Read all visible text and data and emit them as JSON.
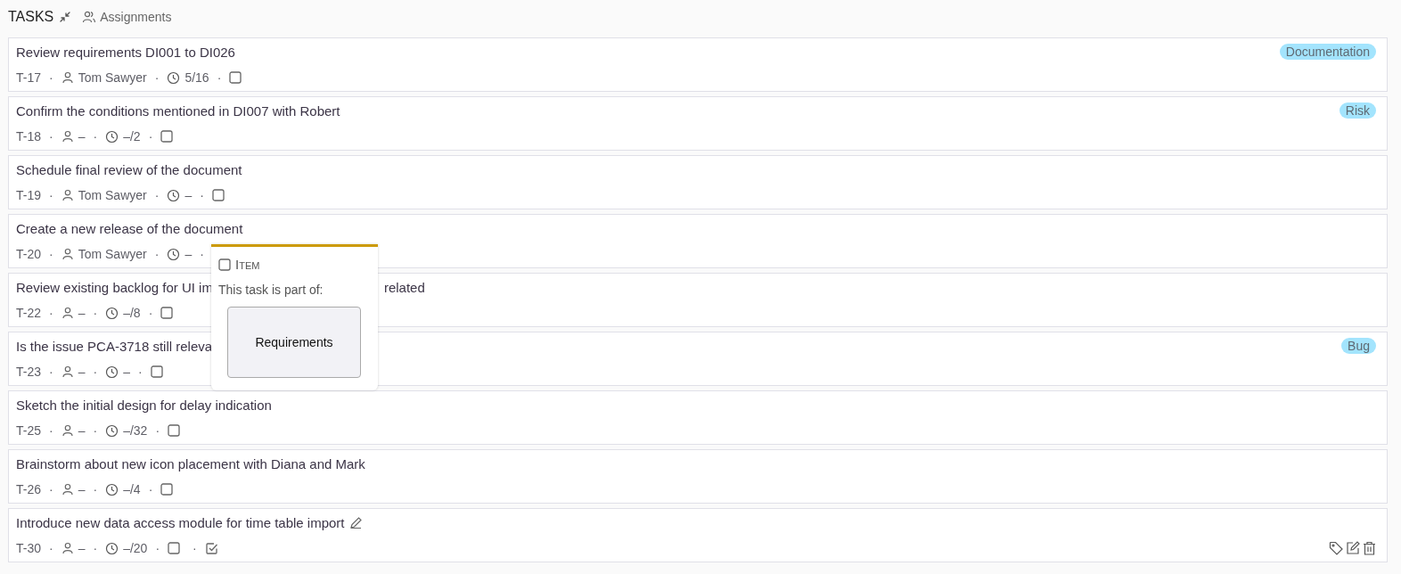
{
  "header": {
    "title": "TASKS",
    "assignments_link": "Assignments"
  },
  "separator": "·",
  "tasks": [
    {
      "title": "Review requirements DI001 to DI026",
      "id": "T-17",
      "assignee": "Tom Sawyer",
      "time": "5/16",
      "checkbox": true,
      "tag": {
        "label": "Documentation",
        "color": "#a3e4fd"
      }
    },
    {
      "title": "Confirm the conditions mentioned in DI007 with Robert",
      "id": "T-18",
      "assignee": "–",
      "time": "–/2",
      "checkbox": true,
      "tag": {
        "label": "Risk",
        "color": "#a3e4fd"
      }
    },
    {
      "title": "Schedule final review of the document",
      "id": "T-19",
      "assignee": "Tom Sawyer",
      "time": "–",
      "checkbox": true
    },
    {
      "title": "Create a new release of the document",
      "id": "T-20",
      "assignee": "Tom Sawyer",
      "time": "–",
      "checkbox": false
    },
    {
      "title": "Review existing backlog for UI im",
      "title_tail": "related",
      "id": "T-22",
      "assignee": "–",
      "time": "–/8",
      "checkbox": true
    },
    {
      "title": "Is the issue PCA-3718 still releva",
      "id": "T-23",
      "assignee": "–",
      "time": "–",
      "checkbox": true,
      "tag": {
        "label": "Bug",
        "color": "#a3e4fd"
      }
    },
    {
      "title": "Sketch the initial design for delay indication",
      "id": "T-25",
      "assignee": "–",
      "time": "–/32",
      "checkbox": true
    },
    {
      "title": "Brainstorm about new icon placement with Diana and Mark",
      "id": "T-26",
      "assignee": "–",
      "time": "–/4",
      "checkbox": true
    },
    {
      "title": "Introduce new data access module for time table import",
      "id": "T-30",
      "assignee": "–",
      "time": "–/20",
      "checkbox": true,
      "edit_icon": true,
      "done_icon": true,
      "actions": true
    }
  ],
  "popup": {
    "type_label": "Item",
    "text": "This task is part of:",
    "parent_button": "Requirements"
  }
}
